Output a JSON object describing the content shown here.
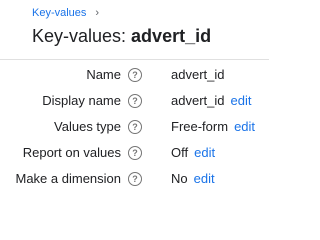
{
  "breadcrumb": {
    "link": "Key-values",
    "separator": "›"
  },
  "title": {
    "prefix": "Key-values: ",
    "name": "advert_id"
  },
  "help_glyph": "?",
  "rows": [
    {
      "label": "Name",
      "value": "advert_id",
      "edit": ""
    },
    {
      "label": "Display name",
      "value": "advert_id",
      "edit": "edit"
    },
    {
      "label": "Values type",
      "value": "Free-form",
      "edit": "edit"
    },
    {
      "label": "Report on values",
      "value": "Off",
      "edit": "edit"
    },
    {
      "label": "Make a dimension",
      "value": "No",
      "edit": "edit"
    }
  ]
}
